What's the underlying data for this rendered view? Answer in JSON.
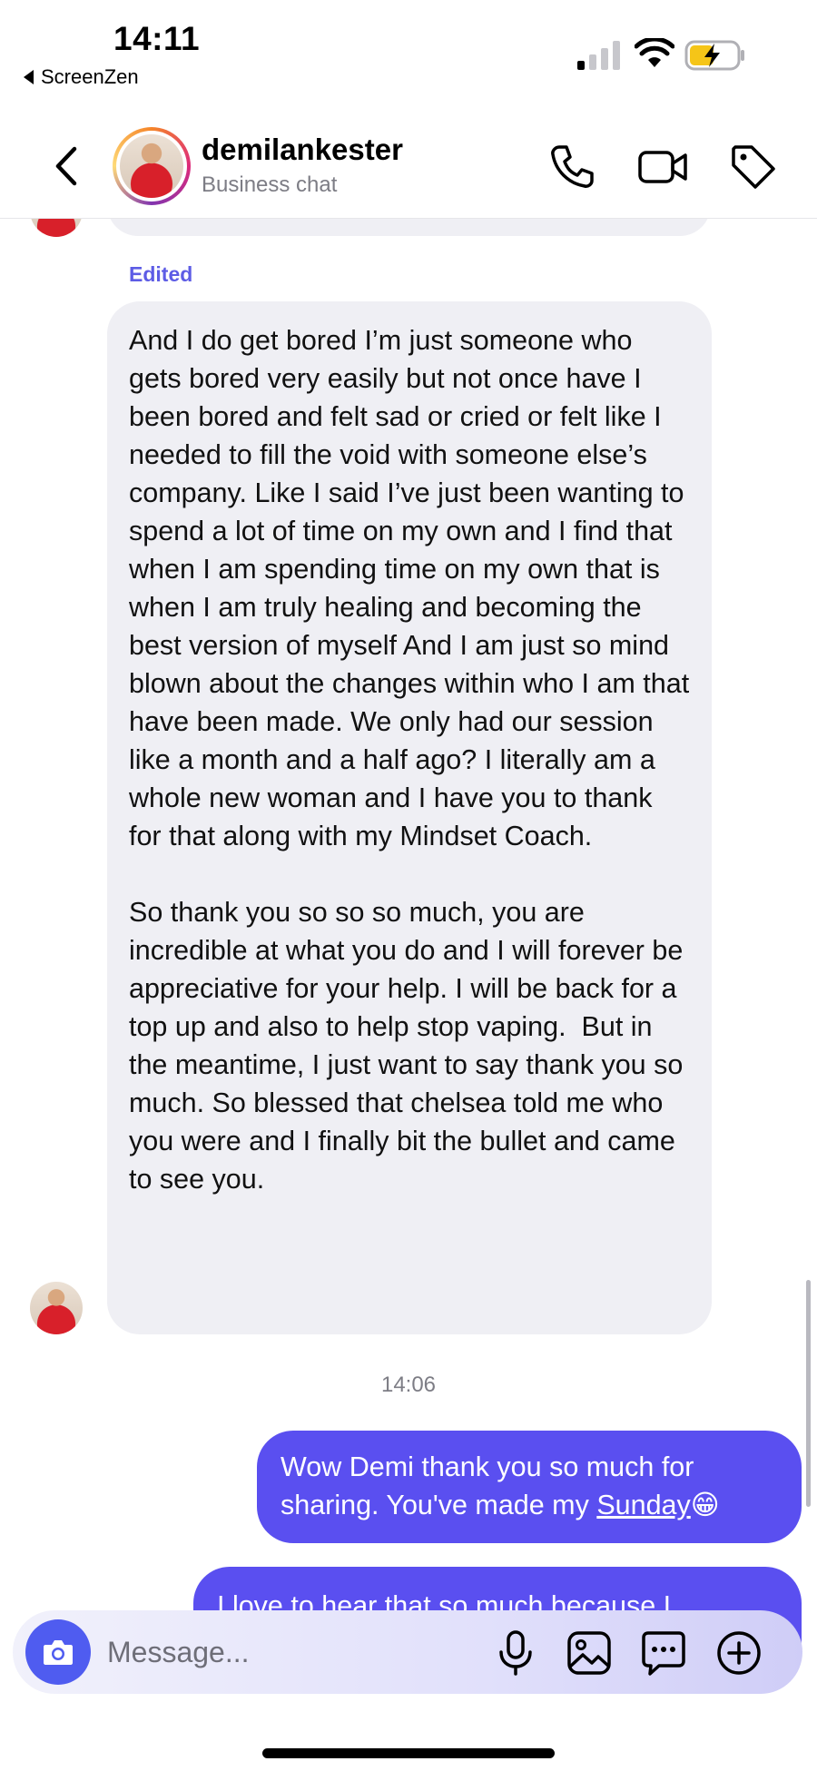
{
  "status_bar": {
    "time": "14:11",
    "back_app": "ScreenZen"
  },
  "header": {
    "username": "demilankester",
    "subtitle": "Business chat",
    "icons": [
      "back-arrow-icon",
      "phone-icon",
      "video-camera-icon",
      "tag-icon"
    ]
  },
  "thread": {
    "edited_label": "Edited",
    "incoming_message": {
      "paragraph_1": "And I do get bored I’m just someone who gets bored very easily but not once have I been bored and felt sad or cried or felt like I needed to fill the void with someone else’s company. Like I said I’ve just been wanting to spend a lot of time on my own and I find that when I am spending time on my own that is when I am truly healing and becoming the best version of myself And I am just so mind blown about the changes within who I am that have been made. We only had our session like a month and a half ago? I literally am a whole new woman and I have you to thank for that along with my Mindset Coach.",
      "paragraph_2": "So thank you so so so much, you are incredible at what you do and I will forever be appreciative for your help. I will be back for a top up and also to help stop vaping.  But in the meantime, I just want to say thank you so much. So blessed that chelsea told me who you were and I finally bit the bullet and came to see you."
    },
    "timestamp": "14:06",
    "outgoing_message_1": {
      "text_before_link": "Wow Demi thank you so much for sharing. You've made my ",
      "link_text": "Sunday",
      "emoji": "😁"
    },
    "outgoing_message_2_partial": "I love to hear that so much because I"
  },
  "composer": {
    "placeholder": "Message...",
    "icons": [
      "camera-icon",
      "microphone-icon",
      "gallery-icon",
      "sticker-icon",
      "plus-icon"
    ]
  },
  "colors": {
    "accent": "#5a4ff0",
    "camera_button": "#4f5cf0",
    "incoming_bubble": "#efeff4",
    "edited_label": "#5d5ce5",
    "battery_fill": "#f5c518"
  }
}
